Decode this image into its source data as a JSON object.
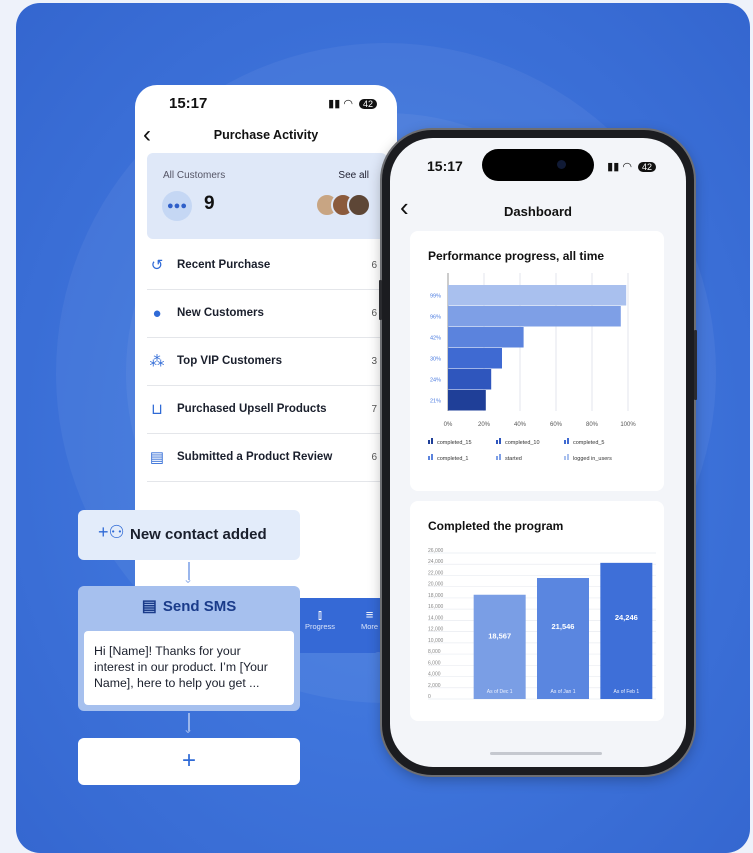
{
  "back_phone": {
    "time": "15:17",
    "battery": "42",
    "nav_title": "Purchase Activity",
    "customers": {
      "label": "All Customers",
      "see_all": "See all",
      "count": "9"
    },
    "rows": [
      {
        "label": "Recent Purchase",
        "count": "6",
        "icon": "history-icon"
      },
      {
        "label": "New Customers",
        "count": "6",
        "icon": "add-customer-icon"
      },
      {
        "label": "Top VIP Customers",
        "count": "3",
        "icon": "vip-group-icon"
      },
      {
        "label": "Purchased Upsell Products",
        "count": "7",
        "icon": "cart-icon"
      },
      {
        "label": "Submitted a Product Review",
        "count": "6",
        "icon": "review-icon"
      }
    ],
    "tabs": {
      "progress": "Progress",
      "more": "More"
    }
  },
  "workflow": {
    "trigger": "New contact added",
    "action": "Send SMS",
    "message": "Hi [Name]! Thanks for your interest in our product. I’m [Your Name], here to help you get ..."
  },
  "front_phone": {
    "time": "15:17",
    "battery": "42",
    "title": "Dashboard"
  },
  "chart_data": [
    {
      "type": "bar",
      "orientation": "horizontal",
      "title": "Performance progress, all time",
      "categories": [
        "logged in_users",
        "started",
        "completed_1",
        "completed_5",
        "completed_10",
        "completed_15"
      ],
      "values": [
        99,
        96,
        42,
        30,
        24,
        21
      ],
      "tick_labels": [
        "99%",
        "96%",
        "42%",
        "30%",
        "24%",
        "21%"
      ],
      "xticks": [
        "0%",
        "20%",
        "40%",
        "60%",
        "80%",
        "100%"
      ],
      "xlim": [
        0,
        100
      ],
      "legend": [
        "completed_15",
        "completed_10",
        "completed_5",
        "completed_1",
        "started",
        "logged in_users"
      ],
      "legend_position": "bottom",
      "colors": [
        "#a9c0ee",
        "#7e9fe6",
        "#5b83dd",
        "#3f6ad2",
        "#2f56bd",
        "#1f3f98"
      ],
      "grid": true
    },
    {
      "type": "bar",
      "title": "Completed the program",
      "categories": [
        "As of Dec 1",
        "As of Jan 1",
        "As of Feb 1"
      ],
      "values": [
        18567,
        21546,
        24246
      ],
      "data_labels": [
        "18,567",
        "21,546",
        "24,246"
      ],
      "yticks": [
        "26,000",
        "24,000",
        "22,000",
        "20,000",
        "18,000",
        "16,000",
        "14,000",
        "12,000",
        "10,000",
        "8,000",
        "6,000",
        "4,000",
        "2,000",
        "0"
      ],
      "ylim": [
        0,
        26000
      ],
      "colors": [
        "#7a9ee5",
        "#5a86e0",
        "#3e6fd8"
      ],
      "grid": true
    }
  ]
}
